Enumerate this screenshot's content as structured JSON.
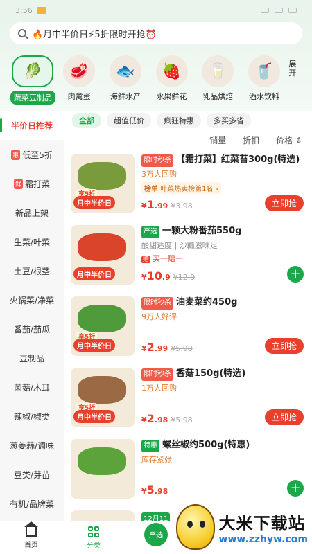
{
  "status": {
    "time": "3:56"
  },
  "search": {
    "text": "🔥月中半价日⚡5折限时开抢⏰"
  },
  "categories": [
    {
      "label": "蔬菜豆制品",
      "emoji": "🥬",
      "active": true
    },
    {
      "label": "肉禽蛋",
      "emoji": "🥩"
    },
    {
      "label": "海鲜水产",
      "emoji": "🐟"
    },
    {
      "label": "水果鲜花",
      "emoji": "🍓"
    },
    {
      "label": "乳品烘焙",
      "emoji": "🥛"
    },
    {
      "label": "酒水饮料",
      "emoji": "🥤"
    }
  ],
  "more_label": "展开",
  "sidebar": [
    {
      "label": "半价日推荐",
      "active": true
    },
    {
      "label": "低至5折",
      "tag": "惠"
    },
    {
      "label": "霜打菜",
      "tag": "鲜"
    },
    {
      "label": "新品上架"
    },
    {
      "label": "生菜/叶菜"
    },
    {
      "label": "土豆/根茎"
    },
    {
      "label": "火锅菜/净菜"
    },
    {
      "label": "番茄/茄瓜"
    },
    {
      "label": "豆制品"
    },
    {
      "label": "菌菇/木耳"
    },
    {
      "label": "辣椒/椒类"
    },
    {
      "label": "葱姜蒜/调味"
    },
    {
      "label": "豆类/芽苗"
    },
    {
      "label": "有机/品牌菜"
    }
  ],
  "filters": [
    "全部",
    "超值低价",
    "疯狂特惠",
    "多买多省"
  ],
  "sorts": [
    "销量",
    "折扣",
    "价格 ⇕"
  ],
  "products": [
    {
      "tag": "限时秒杀",
      "title": "【霜打菜】红菜苔300g(特选)",
      "sub": "3万人回购",
      "rank": "叶菜热卖榜第1名 ›",
      "rank_tag": "榜单",
      "price_int": "1",
      "price_dec": ".99",
      "old": "¥3.98",
      "action": "立即抢",
      "badge": "月中半价日",
      "badge2": "享5折",
      "color": "#7a9b3c"
    },
    {
      "tag": "严选",
      "title": "一颗大粉番茄550g",
      "sub": "酸甜适度 | 沙瓤滋味足",
      "gift": "买一赠一",
      "gift_tag": "赠",
      "price_int": "10",
      "price_dec": ".9",
      "old": "¥12.9",
      "action": "+",
      "badge": "月中半价日",
      "color": "#d9442b"
    },
    {
      "tag": "限时秒杀",
      "title": "油麦菜约450g",
      "sub": "9万人好评",
      "price_int": "2",
      "price_dec": ".99",
      "old": "¥5.98",
      "action": "立即抢",
      "badge": "月中半价日",
      "badge2": "享5折",
      "color": "#4f9a3a"
    },
    {
      "tag": "限时秒杀",
      "title": "香菇150g(特选)",
      "sub": "1万人回购",
      "price_int": "2",
      "price_dec": ".98",
      "old": "¥5.98",
      "action": "立即抢",
      "badge": "月中半价日",
      "badge2": "享5折",
      "color": "#9b6a44"
    },
    {
      "tag": "特惠",
      "title": "螺丝椒约500g(特惠)",
      "sub": "库存紧张",
      "price_int": "5",
      "price_dec": ".98",
      "old": "",
      "action": "+",
      "color": "#5ba33a"
    }
  ],
  "partial": {
    "date": "12月11"
  },
  "nav": {
    "home": "首页",
    "category": "分类",
    "yanxuan": "严选"
  },
  "watermark": {
    "title": "大米下载站",
    "url": "www.zzhyw.com"
  }
}
